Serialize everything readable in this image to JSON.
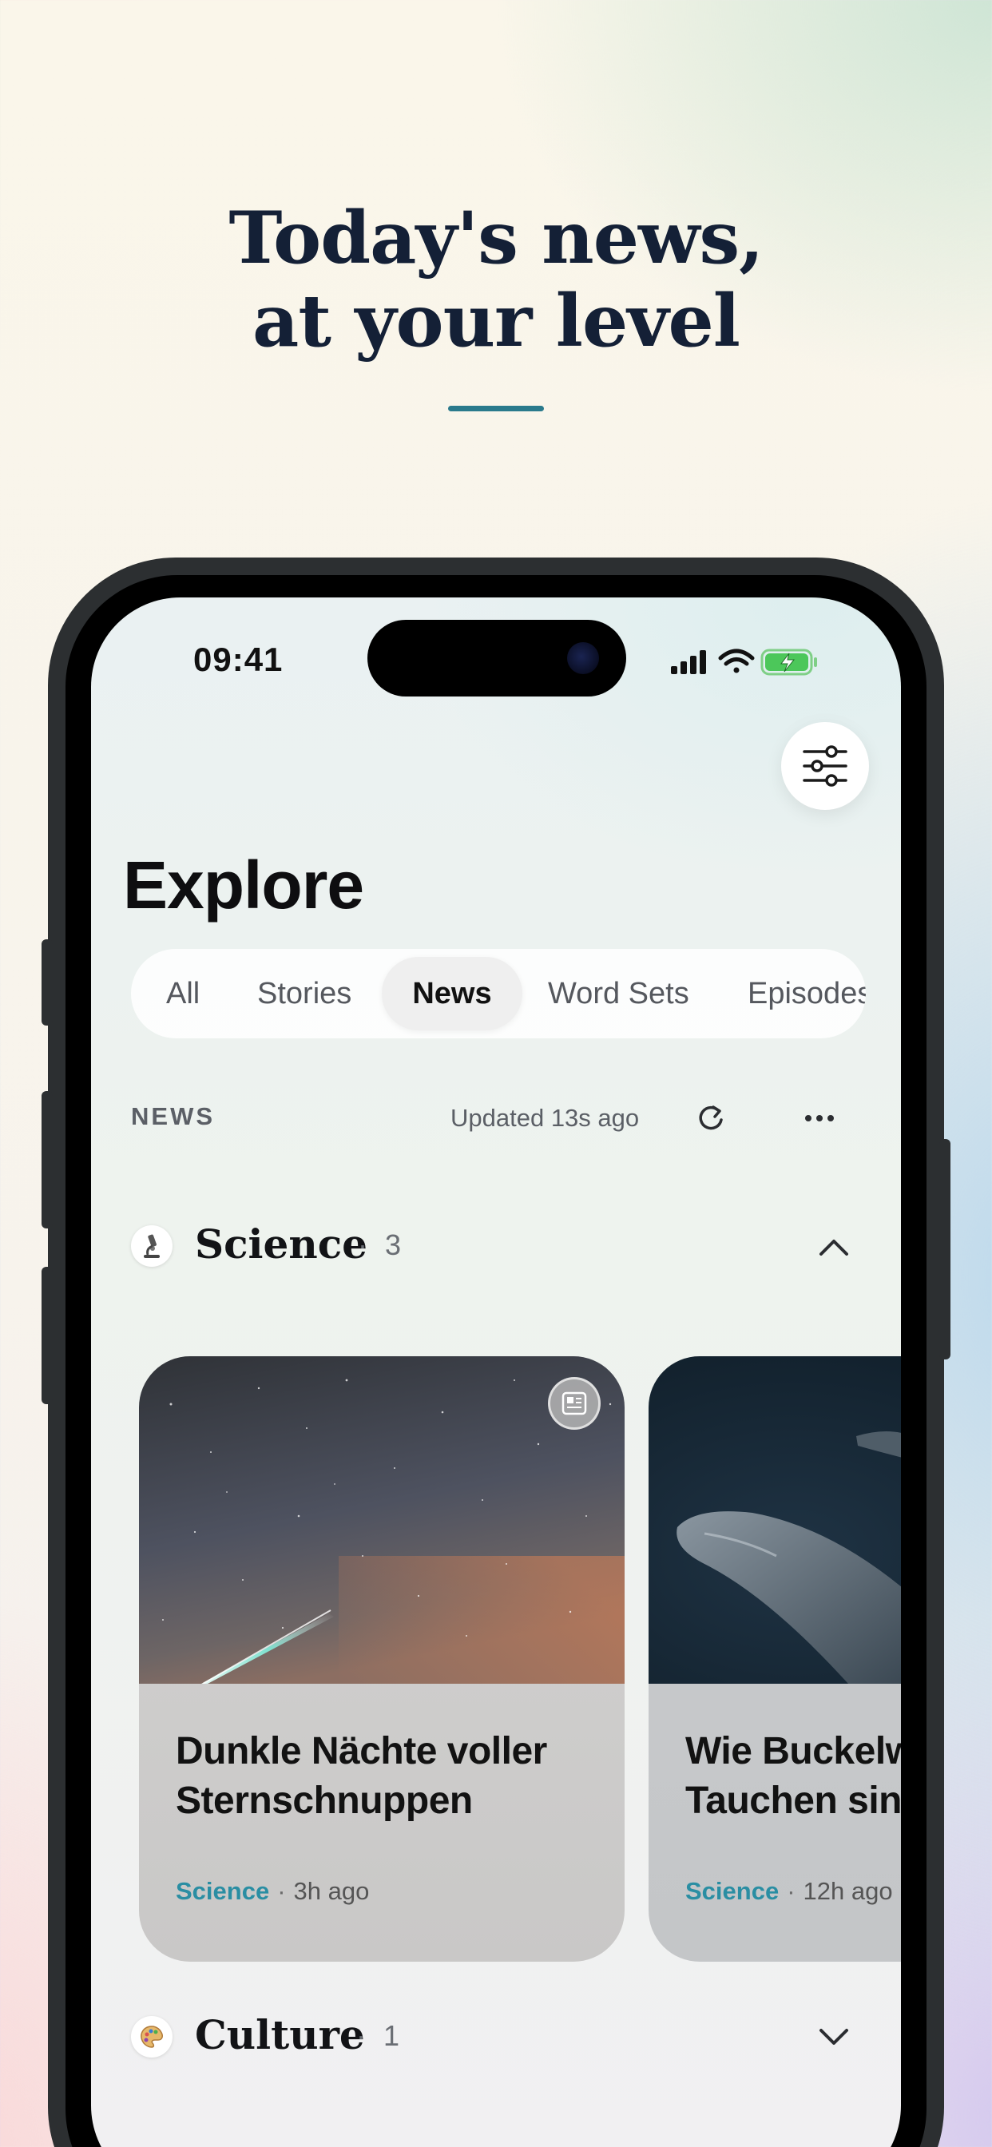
{
  "hero": {
    "title_line1": "Today's news,",
    "title_line2": "at your level"
  },
  "status_bar": {
    "time": "09:41",
    "icons": [
      "signal-icon",
      "wifi-icon",
      "battery-charging-icon"
    ]
  },
  "header": {
    "title": "Explore",
    "filter_icon": "sliders-icon"
  },
  "tabs": [
    {
      "label": "All",
      "active": false
    },
    {
      "label": "Stories",
      "active": false
    },
    {
      "label": "News",
      "active": true
    },
    {
      "label": "Word Sets",
      "active": false
    },
    {
      "label": "Episodes",
      "active": false
    }
  ],
  "news_section": {
    "heading": "NEWS",
    "updated": "Updated 13s ago"
  },
  "categories": [
    {
      "name": "Science",
      "separator": "·",
      "count": "3",
      "icon": "microscope-icon",
      "expanded": true,
      "articles": [
        {
          "title_line1": "Dunkle Nächte voller",
          "title_line2": "Sternschnuppen",
          "category": "Science",
          "time": "3h ago",
          "image": "night-sky-meteor"
        },
        {
          "title_line1": "Wie Buckelw",
          "title_line2": "Tauchen sin",
          "category": "Science",
          "time": "12h ago",
          "image": "humpback-whales-underwater"
        }
      ]
    },
    {
      "name": "Culture",
      "separator": "·",
      "count": "1",
      "icon": "palette-icon",
      "expanded": false
    }
  ],
  "colors": {
    "accent": "#2a7a8c",
    "category_link": "#2a8ea3",
    "title_ink": "#142036"
  }
}
